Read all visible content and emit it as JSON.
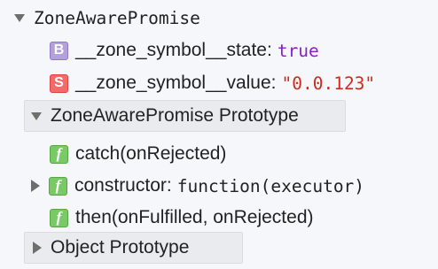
{
  "root": {
    "label": "ZoneAwarePromise",
    "expanded": true
  },
  "props": [
    {
      "badge": "B",
      "badge_type": "boolean",
      "name": "__zone_symbol__state",
      "value": "true"
    },
    {
      "badge": "S",
      "badge_type": "string",
      "name": "__zone_symbol__value",
      "value": "\"0.0.123\""
    }
  ],
  "zone_proto": {
    "label": "ZoneAwarePromise Prototype",
    "expanded": true,
    "methods": [
      {
        "badge": "f",
        "label": "catch(onRejected)",
        "expandable": false
      },
      {
        "badge": "f",
        "name": "constructor",
        "value": "function(executor)",
        "expandable": true
      },
      {
        "badge": "f",
        "label": "then(onFulfilled, onRejected)",
        "expandable": false
      }
    ]
  },
  "object_proto": {
    "label": "Object Prototype",
    "expanded": false
  },
  "colors": {
    "background": "#f5f7fa",
    "boolean_badge": "#b3a1da",
    "string_badge": "#f36b68",
    "function_badge": "#79c966",
    "boolean_value": "#8a1fc4",
    "string_value": "#d12a1a"
  },
  "icons": {
    "expanded": "triangle-down-icon",
    "collapsed": "triangle-right-icon"
  }
}
